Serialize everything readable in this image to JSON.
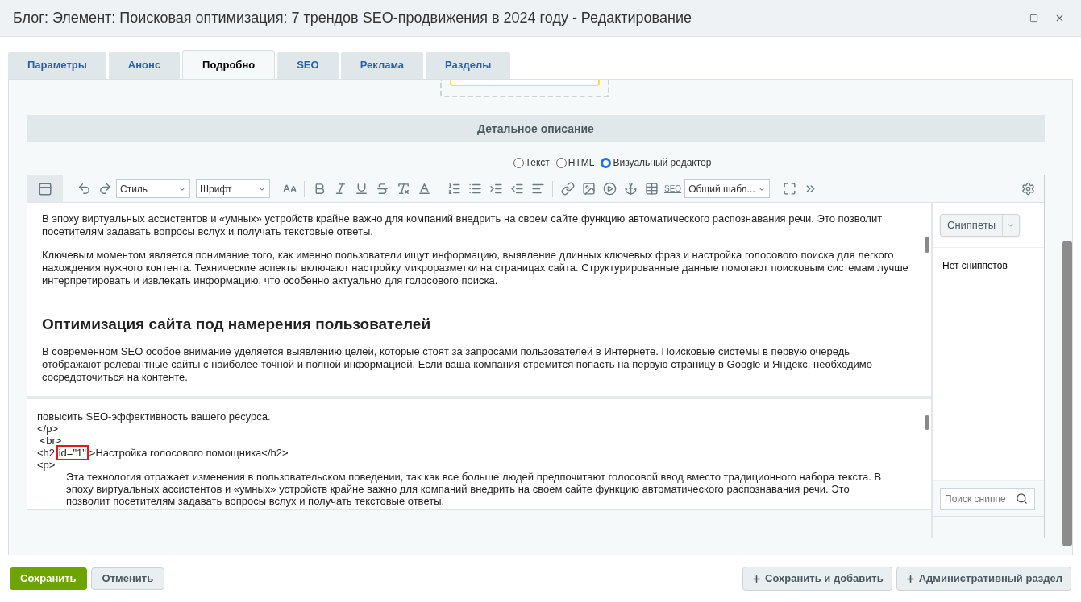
{
  "window": {
    "title": "Блог: Элемент: Поисковая оптимизация: 7 трендов SEO-продвижения в 2024 году - Редактирование"
  },
  "tabs": [
    {
      "label": "Параметры",
      "selected": false
    },
    {
      "label": "Анонс",
      "selected": false
    },
    {
      "label": "Подробно",
      "selected": true
    },
    {
      "label": "SEO",
      "selected": false
    },
    {
      "label": "Реклама",
      "selected": false
    },
    {
      "label": "Разделы",
      "selected": false
    }
  ],
  "section_title": "Детальное описание",
  "view_modes": [
    {
      "label": "Текст",
      "selected": false
    },
    {
      "label": "HTML",
      "selected": false
    },
    {
      "label": "Визуальный редактор",
      "selected": true
    }
  ],
  "toolbar": {
    "style_select": "Стиль",
    "font_select": "Шрифт",
    "seo_button": "SEO",
    "template_select": "Общий шабл..."
  },
  "visual_blocks": [
    {
      "kind": "paragraph",
      "text": "В эпоху виртуальных ассистентов и «умных» устройств крайне важно для компаний внедрить на своем сайте функцию автоматического распознавания речи. Это позволит посетителям задавать вопросы вслух и получать текстовые ответы."
    },
    {
      "kind": "paragraph",
      "text": "Ключевым моментом является понимание того, как именно пользователи ищут информацию, выявление длинных ключевых фраз и настройка голосового поиска для легкого нахождения нужного контента. Технические аспекты включают настройку микроразметки на страницах сайта. Структурированные данные помогают поисковым системам лучше интерпретировать и извлекать информацию, что особенно актуально для голосового поиска."
    },
    {
      "kind": "heading",
      "text": "Оптимизация сайта под намерения пользователей"
    },
    {
      "kind": "paragraph",
      "text": "В современном SEO особое внимание уделяется выявлению целей, которые стоят за запросами пользователей в Интернете. Поисковые системы в первую очередь отображают релевантные сайты с наиболее точной и полной информацией. Если ваша компания стремится попасть на первую страницу в Google и Яндекс, необходимо сосредоточиться на контенте."
    }
  ],
  "source_lines": [
    {
      "kind": "text",
      "text": "повысить SEO-эффективность вашего ресурса."
    },
    {
      "kind": "text",
      "text": "</p>"
    },
    {
      "kind": "text",
      "text": " <br>"
    },
    {
      "kind": "marked",
      "before": "<h2 ",
      "mark": "id=\"1\"",
      "after": ">Настройка голосового помощника</h2>"
    },
    {
      "kind": "text",
      "text": "<p>"
    },
    {
      "kind": "indented",
      "text": "Эта технология отражает изменения в пользовательском поведении, так как все больше людей предпочитают голосовой ввод вместо традиционного набора текста. В эпоху виртуальных ассистентов и «умных» устройств крайне важно для компаний внедрить на своем сайте функцию автоматического распознавания речи. Это позволит посетителям задавать вопросы вслух и получать текстовые ответы."
    }
  ],
  "snippets": {
    "button": "Сниппеты",
    "empty": "Нет сниппетов",
    "search_placeholder": "Поиск сниппе"
  },
  "footer": {
    "left": [
      "Сохранить",
      "Отменить"
    ],
    "right": [
      "Сохранить и добавить",
      "Административный раздел"
    ]
  }
}
